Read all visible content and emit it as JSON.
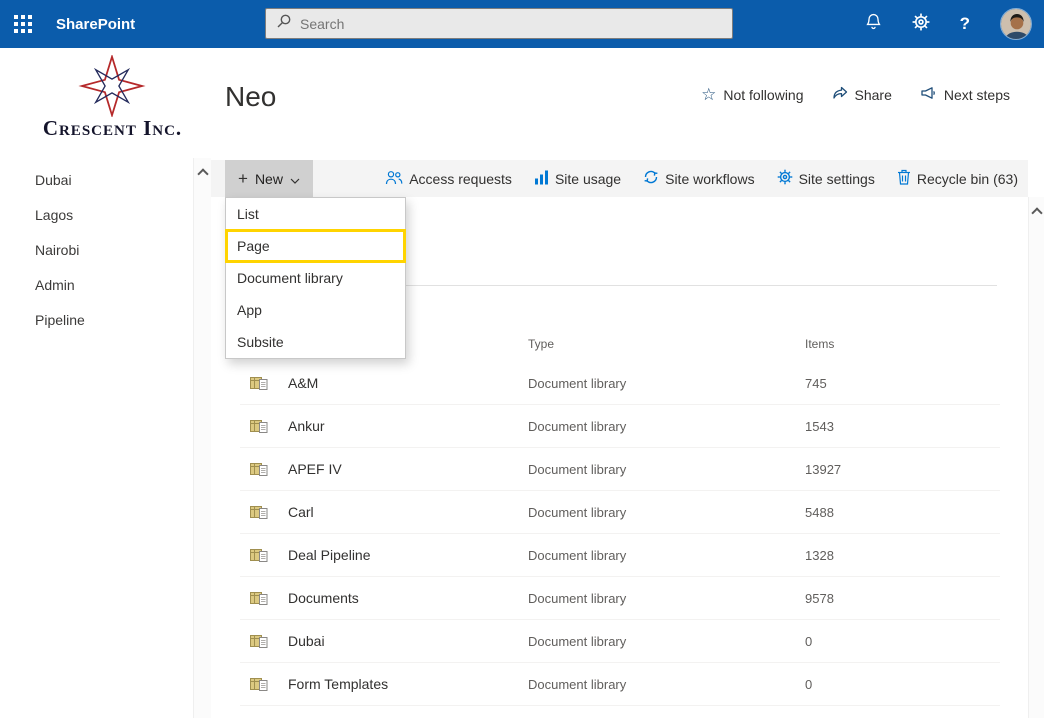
{
  "colors": {
    "suite_bar_bg": "#0b5cab",
    "accent": "#0078d4",
    "highlight": "#ffd400",
    "text_primary": "#323130",
    "text_secondary": "#605e5c"
  },
  "suite_bar": {
    "brand": "SharePoint",
    "search": {
      "placeholder": "Search"
    },
    "help_glyph": "?"
  },
  "site_header": {
    "logo_text": "Crescent Inc.",
    "site_title": "Neo",
    "actions": [
      {
        "icon": "star",
        "label": "Not following"
      },
      {
        "icon": "share",
        "label": "Share"
      },
      {
        "icon": "megaphone",
        "label": "Next steps"
      }
    ]
  },
  "sidebar": {
    "items": [
      {
        "label": "Dubai"
      },
      {
        "label": "Lagos"
      },
      {
        "label": "Nairobi"
      },
      {
        "label": "Admin"
      },
      {
        "label": "Pipeline"
      }
    ]
  },
  "command_bar": {
    "new_label": "New",
    "actions": [
      {
        "icon": "people",
        "label": "Access requests"
      },
      {
        "icon": "bar-chart",
        "label": "Site usage"
      },
      {
        "icon": "sync",
        "label": "Site workflows"
      },
      {
        "icon": "gear",
        "label": "Site settings"
      },
      {
        "icon": "trash",
        "label": "Recycle bin (63)"
      }
    ]
  },
  "new_menu": {
    "items": [
      {
        "label": "List",
        "highlighted": false
      },
      {
        "label": "Page",
        "highlighted": true
      },
      {
        "label": "Document library",
        "highlighted": false
      },
      {
        "label": "App",
        "highlighted": false
      },
      {
        "label": "Subsite",
        "highlighted": false
      }
    ]
  },
  "table": {
    "columns": {
      "type": "Type",
      "items": "Items"
    },
    "rows": [
      {
        "name": "A&M",
        "type": "Document library",
        "items": "745"
      },
      {
        "name": "Ankur",
        "type": "Document library",
        "items": "1543"
      },
      {
        "name": "APEF IV",
        "type": "Document library",
        "items": "13927"
      },
      {
        "name": "Carl",
        "type": "Document library",
        "items": "5488"
      },
      {
        "name": "Deal Pipeline",
        "type": "Document library",
        "items": "1328"
      },
      {
        "name": "Documents",
        "type": "Document library",
        "items": "9578"
      },
      {
        "name": "Dubai",
        "type": "Document library",
        "items": "0"
      },
      {
        "name": "Form Templates",
        "type": "Document library",
        "items": "0"
      }
    ]
  }
}
